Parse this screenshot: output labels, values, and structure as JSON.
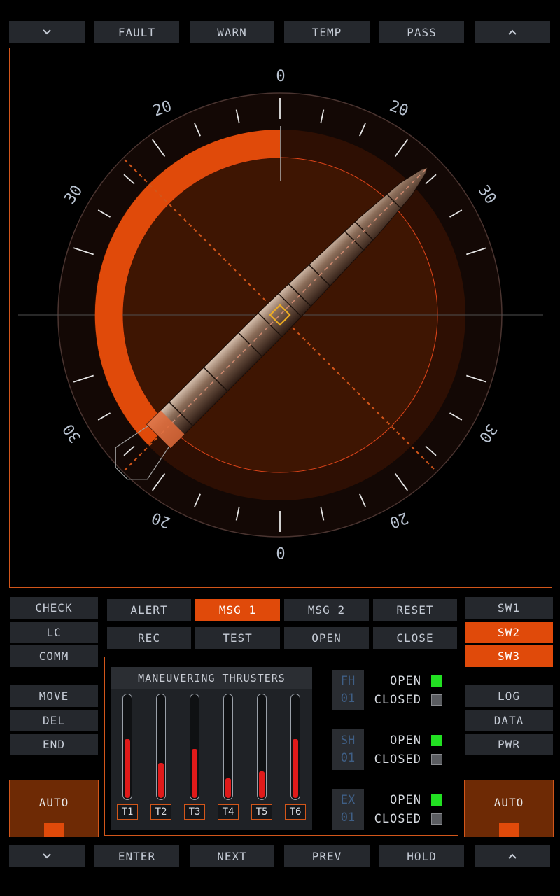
{
  "top_bar": {
    "down_icon": "chevron-down-icon",
    "items": [
      "FAULT",
      "WARN",
      "TEMP",
      "PASS"
    ],
    "up_icon": "chevron-up-icon"
  },
  "bottom_bar": {
    "down_icon": "chevron-down-icon",
    "items": [
      "ENTER",
      "NEXT",
      "PREV",
      "HOLD"
    ],
    "up_icon": "chevron-up-icon"
  },
  "gauge": {
    "top_label": "0",
    "bottom_label": "0",
    "labels_20": [
      "20",
      "20",
      "20",
      "20"
    ],
    "labels_30": [
      "30",
      "30",
      "30",
      "30"
    ],
    "arc_color": "#e04a0a"
  },
  "left_panel": {
    "group1": [
      "CHECK",
      "LC",
      "COMM"
    ],
    "group2": [
      "MOVE",
      "DEL",
      "END"
    ],
    "auto_label": "AUTO"
  },
  "right_panel": {
    "switches": [
      "SW1",
      "SW2",
      "SW3"
    ],
    "active": [
      "SW2",
      "SW3"
    ],
    "group2": [
      "LOG",
      "DATA",
      "PWR"
    ],
    "auto_label": "AUTO"
  },
  "messages": {
    "row1": [
      "ALERT",
      "MSG 1",
      "MSG 2",
      "RESET"
    ],
    "row2": [
      "REC",
      "TEST",
      "OPEN",
      "CLOSE"
    ],
    "active": "MSG 1"
  },
  "thrusters": {
    "title": "MANEUVERING THRUSTERS",
    "items": [
      {
        "label": "T1",
        "level": 0.57
      },
      {
        "label": "T2",
        "level": 0.34
      },
      {
        "label": "T3",
        "level": 0.47
      },
      {
        "label": "T4",
        "level": 0.19
      },
      {
        "label": "T5",
        "level": 0.26
      },
      {
        "label": "T6",
        "level": 0.57
      }
    ]
  },
  "valves": [
    {
      "code_line1": "FH",
      "code_line2": "01",
      "open_label": "OPEN",
      "closed_label": "CLOSED",
      "state": "open"
    },
    {
      "code_line1": "SH",
      "code_line2": "01",
      "open_label": "OPEN",
      "closed_label": "CLOSED",
      "state": "open"
    },
    {
      "code_line1": "EX",
      "code_line2": "01",
      "open_label": "OPEN",
      "closed_label": "CLOSED",
      "state": "open"
    }
  ],
  "colors": {
    "accent": "#e04a0a",
    "open_led": "#22e022",
    "closed_led": "#5a5c60"
  }
}
